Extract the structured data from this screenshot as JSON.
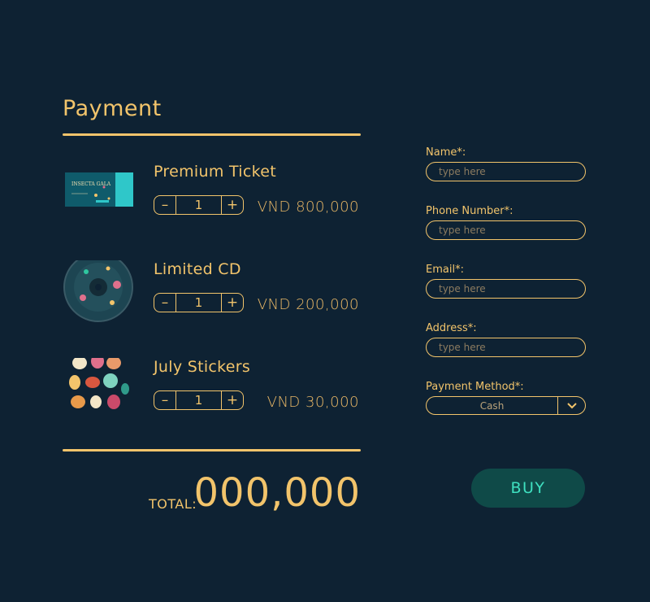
{
  "page": {
    "title": "Payment"
  },
  "items": [
    {
      "name": "Premium Ticket",
      "qty": "1",
      "price": "VND 800,000",
      "minus": "–",
      "plus": "+",
      "ticket_text": "INSECTA GALA"
    },
    {
      "name": "Limited CD",
      "qty": "1",
      "price": "VND 200,000",
      "minus": "–",
      "plus": "+"
    },
    {
      "name": "July Stickers",
      "qty": "1",
      "price": "VND 30,000",
      "minus": "–",
      "plus": "+"
    }
  ],
  "total": {
    "label": "TOTAL:",
    "value": "000,000"
  },
  "form": {
    "name": {
      "label": "Name*:",
      "placeholder": "type here"
    },
    "phone": {
      "label": "Phone Number*:",
      "placeholder": "type here"
    },
    "email": {
      "label": "Email*:",
      "placeholder": "type here"
    },
    "address": {
      "label": "Address*:",
      "placeholder": "type here"
    },
    "payment_method": {
      "label": "Payment Method*:",
      "value": "Cash"
    }
  },
  "buy_label": "BUY",
  "colors": {
    "background": "#0e2233",
    "accent": "#f2c46b",
    "buy_bg": "#0f4a48",
    "buy_text": "#3fe0c0"
  }
}
